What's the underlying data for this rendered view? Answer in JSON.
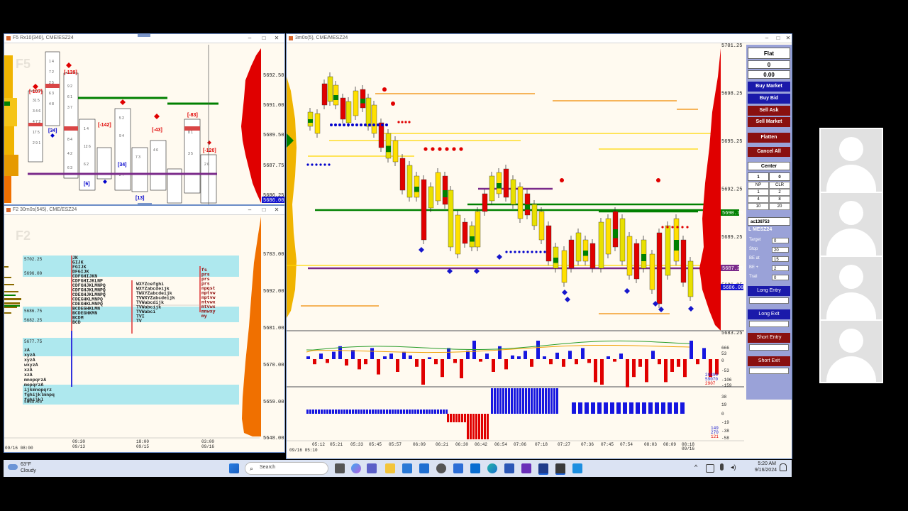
{
  "windows": {
    "f5": {
      "title": "F5 Rx10(340), CME/ESZ24",
      "watermark": "F5",
      "last_price": "5686.00",
      "prices": [
        "5692.50",
        "5691.00",
        "5689.50",
        "5687.75",
        "5686.25"
      ]
    },
    "f2": {
      "title": "F2 30m0s(545), CME/ESZ24",
      "watermark": "F2",
      "prices": [
        "5703.00",
        "5692.00",
        "5681.00",
        "5670.00",
        "5659.00",
        "5648.00"
      ],
      "levels": [
        "5702.25",
        "5696.00",
        "5686.75",
        "5682.25",
        "5677.75",
        "5658.00"
      ],
      "time_labels": [
        {
          "time": "09:30",
          "date": "09/13"
        },
        {
          "time": "18:00",
          "date": "09/15"
        },
        {
          "time": "03:00",
          "date": "09/16"
        }
      ],
      "start_date": "09/16 08:00",
      "tpo_rows": [
        "JK",
        "GIJK",
        "FGIJK",
        "DFGIJK",
        "CDFGHIJKN",
        "CDFGHIJKLNP",
        "CDFGHJKLMNPQ",
        "CDFGHJKLMNPQ",
        "CDEGHJKLMNPQ",
        "CDEGHKLMNPQ",
        "CDEGHKLMNPQ",
        "BCDEGHKLMN",
        "BCDEGHKMN",
        "BCDM",
        "BCD"
      ],
      "tpo_right_rows": [
        "WXYZcefghi",
        "WXYZabcdeijk",
        "TWXYZabcdeijk",
        "TVWXYZabcdeijk",
        "TVWabcdijk",
        "TVWabcijk",
        "TVWabci",
        "TVI",
        "TV"
      ],
      "tpo_far_rows": [
        "fs",
        "prs",
        "prs",
        "prs",
        "npqst",
        "nptvw",
        "nptvw",
        "ntvwx",
        "mtvwx",
        "mnwxy",
        "my"
      ],
      "tpo_low_rows": [
        "zA",
        "xyzA",
        "xyzA",
        "wxyzA",
        "xzA",
        "xzA",
        "mnopqrzA",
        "mopqrzA",
        "ijkmnopqrz",
        "fghijklmnpq",
        "fghijkl"
      ]
    },
    "main": {
      "title": "3m0s(5), CME/MESZ24",
      "last_price": "5686.00",
      "value_price": "5690.75",
      "pivot_price": "5687.25",
      "prices": [
        "5701.25",
        "5698.25",
        "5695.25",
        "5692.25",
        "5689.25",
        "5686.25",
        "5683.25"
      ],
      "time_labels": [
        "05:12",
        "05:21",
        "05:33",
        "05:45",
        "05:57",
        "06:09",
        "06:21",
        "06:30",
        "06:42",
        "06:54",
        "07:06",
        "07:18",
        "07:27",
        "07:36",
        "07:45",
        "07:54",
        "08:03",
        "08:09",
        "08:18"
      ],
      "last_time_date": "09/16",
      "start_date": "09/16 05:10",
      "osc1_scale": [
        "666",
        "53",
        "0",
        "-53",
        "-106",
        "-159"
      ],
      "osc1_readouts": [
        "29890",
        "59070",
        "2907"
      ],
      "osc2_scale": [
        "38",
        "19",
        "0",
        "-19",
        "-38",
        "-58"
      ],
      "osc2_readouts": [
        "149",
        "270",
        "121"
      ]
    }
  },
  "order_panel": {
    "position": "Flat",
    "qty": "0",
    "pnl": "0.00",
    "buttons": {
      "buy_market": "Buy Market",
      "buy_bid": "Buy Bid",
      "sell_ask": "Sell Ask",
      "sell_market": "Sell Market",
      "flatten": "Flatten",
      "cancel_all": "Cancel All",
      "center": "Center"
    },
    "qty_input": "1",
    "qty_right": "0",
    "grid": [
      [
        "NP",
        "CLR"
      ],
      [
        "1",
        "2"
      ],
      [
        "4",
        "8"
      ],
      [
        "10",
        "20"
      ]
    ],
    "account": "ac138753",
    "symbol": "L MESZ24",
    "settings": [
      {
        "label": "Target",
        "value": "0"
      },
      {
        "label": "Stop",
        "value": "20"
      },
      {
        "label": "BE at",
        "value": "15"
      },
      {
        "label": "BE +",
        "value": "2"
      },
      {
        "label": "Trail",
        "value": "0"
      }
    ],
    "strategy_buttons": [
      "Long Entry",
      "Long Exit",
      "Short Entry",
      "Short Exit"
    ]
  },
  "taskbar": {
    "temperature": "63°F",
    "weather": "Cloudy",
    "search_placeholder": "Search",
    "time": "5:20 AM",
    "date": "9/16/2024"
  },
  "colors": {
    "up": "#e8e000",
    "down": "#ff0000",
    "buy": "#0000ff",
    "poc": "#008000",
    "panel": "#9aa2d8"
  }
}
